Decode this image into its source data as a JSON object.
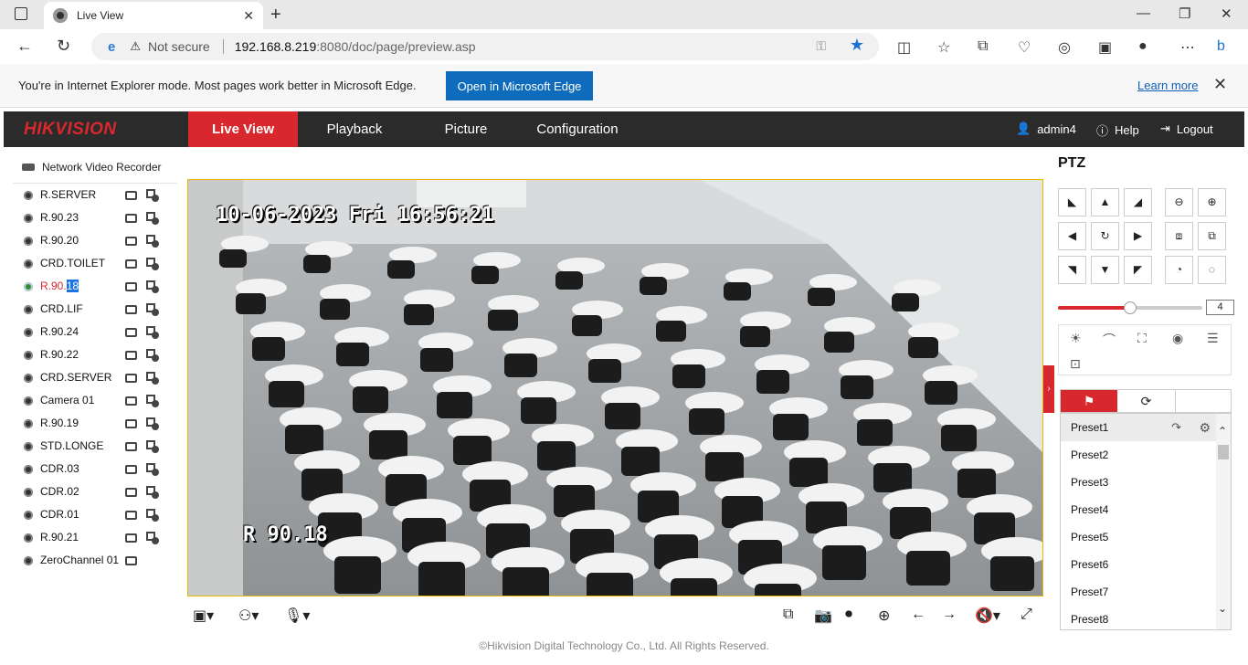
{
  "browser": {
    "tab_title": "Live View",
    "tab_close": "✕",
    "new_tab": "+",
    "min": "—",
    "max": "❐",
    "close": "✕",
    "not_secure": "Not secure",
    "url_host": "192.168.8.219",
    "url_path": ":8080/doc/page/preview.asp",
    "ie_message": "You're in Internet Explorer mode. Most pages work better in Microsoft Edge.",
    "open_edge_label": "Open in Microsoft Edge",
    "learn_more": "Learn more"
  },
  "header": {
    "logo": "HIKVISION",
    "menu": [
      "Live View",
      "Playback",
      "Picture",
      "Configuration"
    ],
    "user": "admin4",
    "help": "Help",
    "logout": "Logout"
  },
  "device_panel": {
    "title": "Network Video Recorder",
    "cameras": [
      "R.SERVER",
      "R.90.23",
      "R.90.20",
      "CRD.TOILET",
      "R.90.18",
      "CRD.LIF",
      "R.90.24",
      "R.90.22",
      "CRD.SERVER",
      "Camera 01",
      "R.90.19",
      "STD.LONGE",
      "CDR.03",
      "CDR.02",
      "CDR.01",
      "R.90.21",
      "ZeroChannel 01"
    ],
    "active_prefix": "R.90.",
    "active_highlight": "18"
  },
  "video": {
    "timestamp": "10-06-2023 Fri 16:56:21",
    "camera_label": "R 90.18"
  },
  "ptz": {
    "title": "PTZ",
    "speed": "4",
    "speed_fraction": 0.5,
    "presets": [
      "Preset1",
      "Preset2",
      "Preset3",
      "Preset4",
      "Preset5",
      "Preset6",
      "Preset7",
      "Preset8"
    ]
  },
  "footer": {
    "copyright": "©Hikvision Digital Technology Co., Ltd. All Rights Reserved."
  },
  "colors": {
    "accent": "#d9272e",
    "header_bg": "#2b2b2b",
    "edge_blue": "#0f6cbd"
  }
}
